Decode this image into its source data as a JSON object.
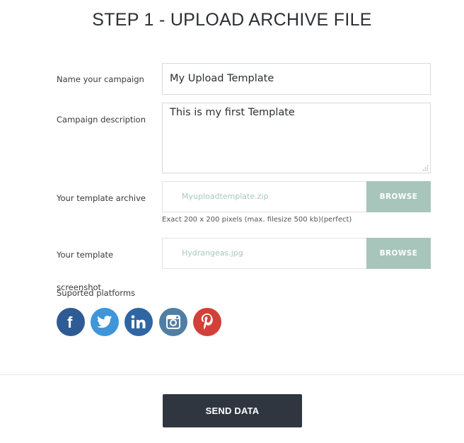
{
  "page": {
    "title": "STEP 1 - UPLOAD ARCHIVE FILE"
  },
  "form": {
    "campaign_name": {
      "label": "Name your campaign",
      "value": "My Upload Template"
    },
    "description": {
      "label": "Campaign description",
      "value": "This is my first Template"
    },
    "archive": {
      "label": "Your template archive",
      "filename": "Myuploadtemplate.zip",
      "browse_label": "BROWSE",
      "hint": "Exact 200 x 200 pixels (max. filesize 500 kb)(perfect)"
    },
    "screenshot": {
      "label_line1": "Your template",
      "label_line2": "screenshot",
      "filename": "Hydrangeas.jpg",
      "browse_label": "BROWSE"
    },
    "platforms": {
      "label": "Suported platforms",
      "items": [
        {
          "name": "facebook",
          "icon": "facebook-icon",
          "color": "#2f5b95"
        },
        {
          "name": "twitter",
          "icon": "twitter-icon",
          "color": "#3f96d8"
        },
        {
          "name": "linkedin",
          "icon": "linkedin-icon",
          "color": "#2e66a3"
        },
        {
          "name": "instagram",
          "icon": "instagram-icon",
          "color": "#517fa4"
        },
        {
          "name": "pinterest",
          "icon": "pinterest-icon",
          "color": "#d2403a"
        }
      ]
    }
  },
  "actions": {
    "send_label": "SEND DATA"
  },
  "colors": {
    "browse": "#a7c5bb",
    "send": "#2f3640",
    "filename_text": "#a8c8bf"
  }
}
